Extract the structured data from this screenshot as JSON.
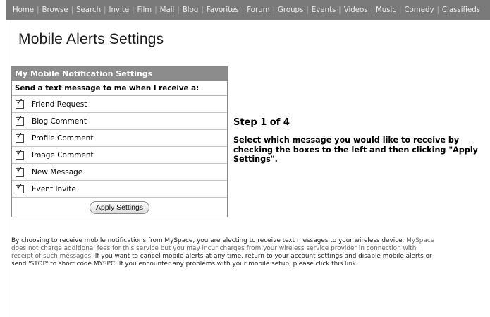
{
  "nav": {
    "items": [
      "Home",
      "Browse",
      "Search",
      "Invite",
      "Film",
      "Mail",
      "Blog",
      "Favorites",
      "Forum",
      "Groups",
      "Events",
      "Videos",
      "Music",
      "Comedy",
      "Classifieds"
    ],
    "separator": "|"
  },
  "page_title": "Mobile Alerts Settings",
  "settings_box": {
    "header": "My Mobile Notification Settings",
    "subheader": "Send a text message to me when I receive a:",
    "options": [
      {
        "label": "Friend Request",
        "checked": true
      },
      {
        "label": "Blog Comment",
        "checked": true
      },
      {
        "label": "Profile Comment",
        "checked": true
      },
      {
        "label": "Image Comment",
        "checked": true
      },
      {
        "label": "New Message",
        "checked": true
      },
      {
        "label": "Event Invite",
        "checked": true
      }
    ],
    "apply_label": "Apply Settings"
  },
  "step": {
    "title": "Step 1 of 4",
    "description": "Select which message you would like to receive by checking the boxes to the left and then clicking \"Apply Settings\"."
  },
  "disclaimer": {
    "l1a": "By choosing to receive mobile notifications from MySpace, you are electing to receive text messages to your wireless device.",
    "l1b": " MySpace",
    "l2": "does not charge additional fees for this service but you may incur charges from your wireless service provider in connection with",
    "l3a": "receipt of such messages.",
    "l3b": " If you want to cancel mobile alerts at any time, return to your account settings and disable mobile alerts or",
    "l4a": "send 'STOP' to short code MYSPC. If you encounter any problems with your mobile setup, please click this",
    "link_text": "link",
    "l4b": "."
  },
  "colors": {
    "nav_bg": "#7a7a7a",
    "box_header_bg": "#8c8c8c",
    "muted_text": "#666666"
  }
}
